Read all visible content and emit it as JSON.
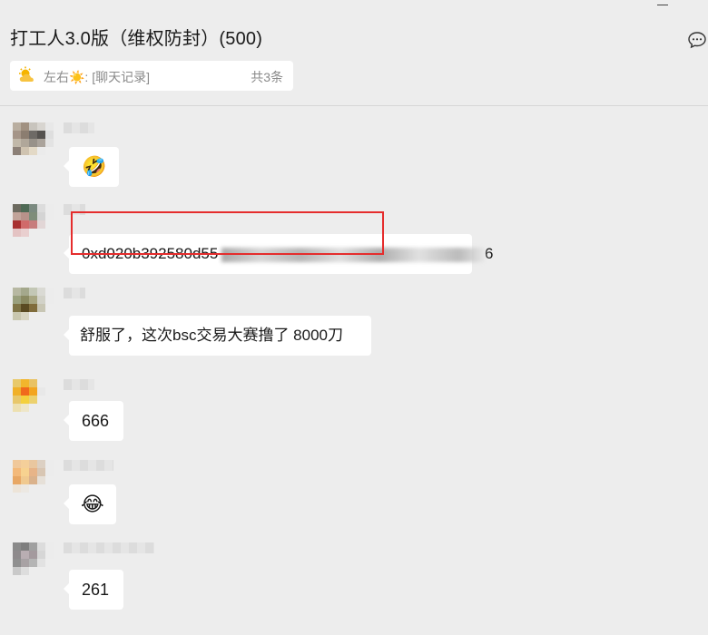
{
  "window": {
    "title": "打工人3.0版（维权防封）(500)"
  },
  "pinned": {
    "icon": "sun-cloud-icon",
    "text": "左右☀️: [聊天记录]",
    "count": "共3条"
  },
  "messages": [
    {
      "type": "emoji",
      "emoji": "🤣"
    },
    {
      "type": "text",
      "prefix": "0xd020b392580d555f35eca1087f27d249",
      "suffix": "6"
    },
    {
      "type": "text",
      "text": "舒服了，这次bsc交易大赛撸了 8000刀",
      "highlighted": true
    },
    {
      "type": "text",
      "text": "666"
    },
    {
      "type": "emoji",
      "emoji": "😂"
    },
    {
      "type": "text",
      "text": "261"
    }
  ],
  "colors": {
    "background": "#ededed",
    "bubble": "#ffffff",
    "highlight_border": "#e52d2d"
  }
}
